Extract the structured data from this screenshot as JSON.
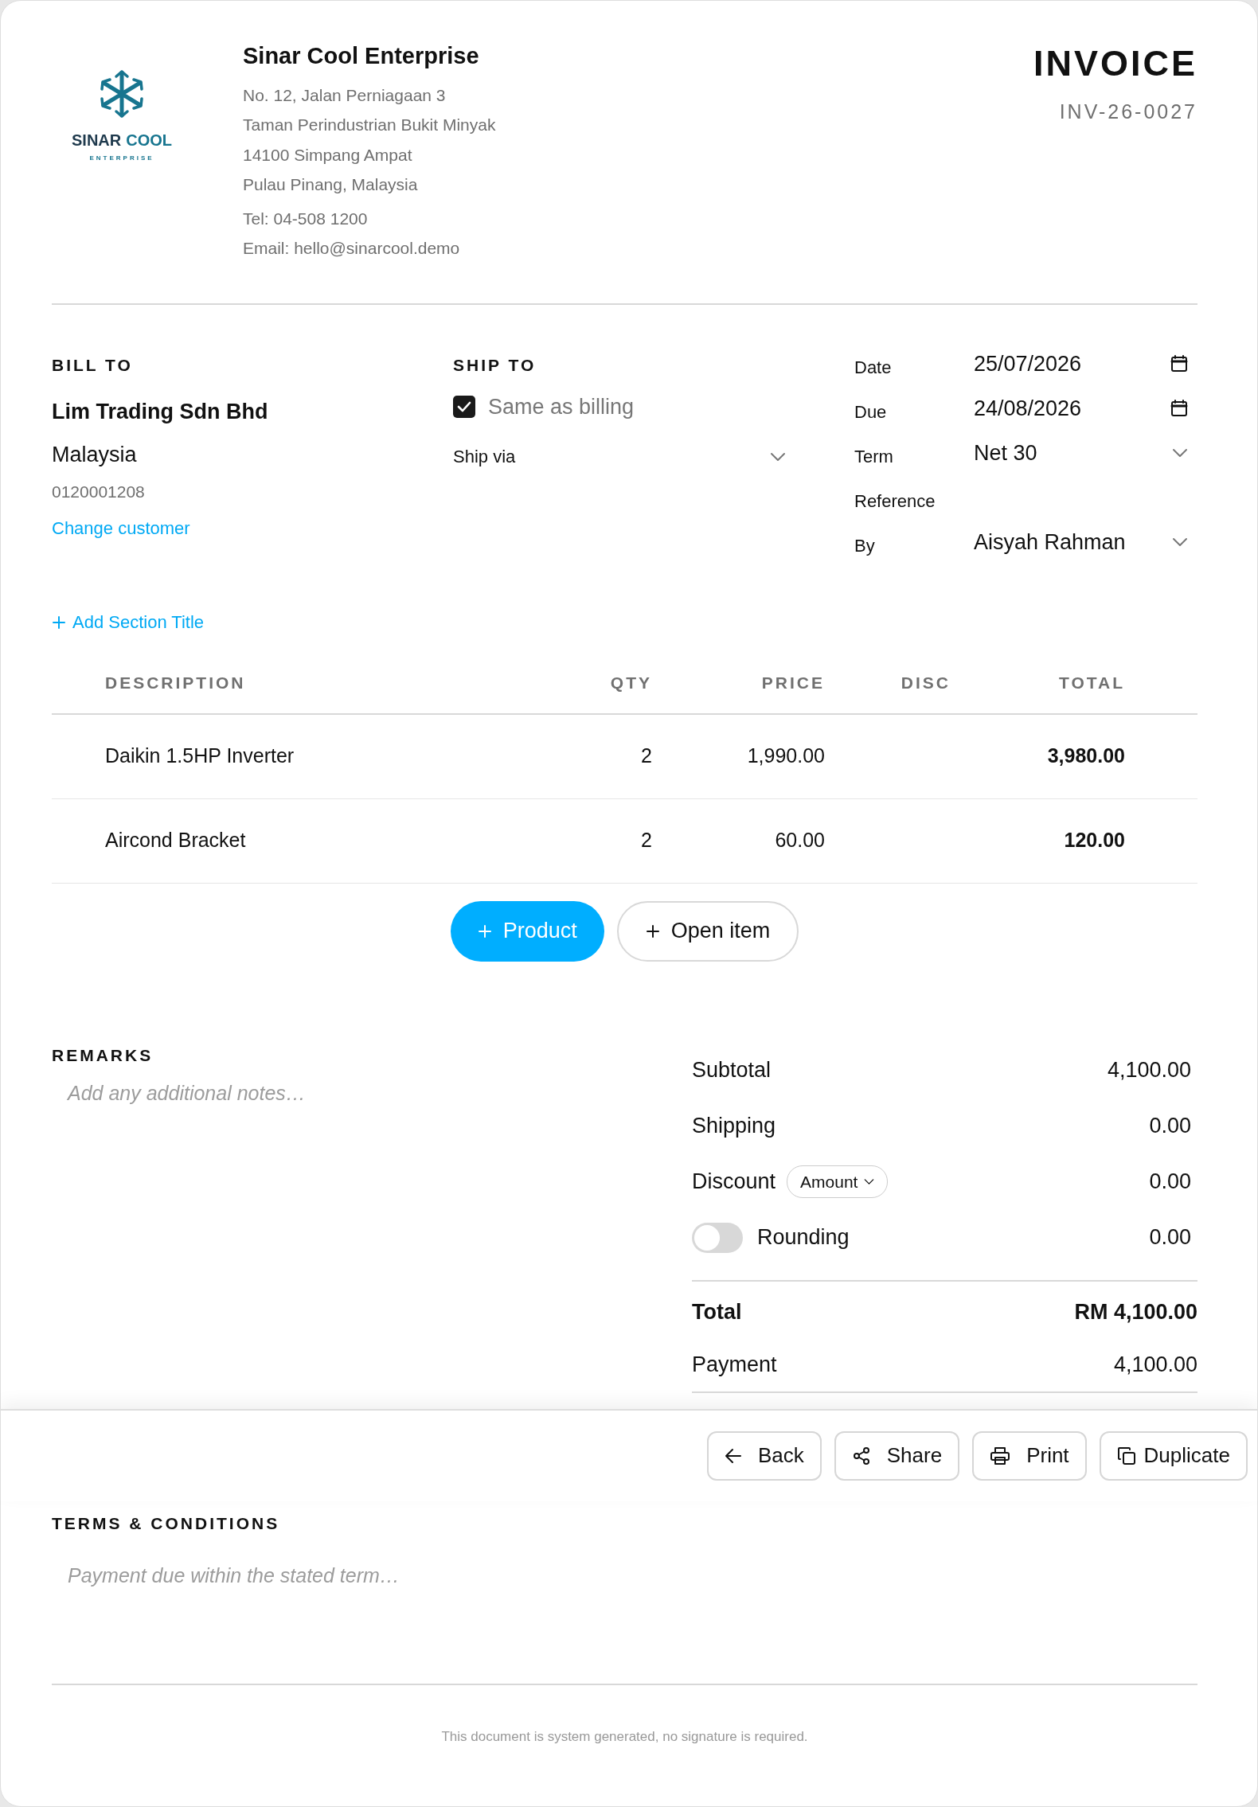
{
  "company": {
    "logo": {
      "words": [
        {
          "text": "SINAR",
          "color": "#1f3a4d"
        },
        {
          "text": "COOL",
          "color": "#17758f"
        }
      ],
      "tagline": "ENTERPRISE"
    },
    "name": "Sinar Cool Enterprise",
    "address_lines": [
      "No. 12, Jalan Perniagaan 3",
      "Taman Perindustrian Bukit Minyak",
      "14100 Simpang Ampat",
      "Pulau Pinang, Malaysia"
    ],
    "contact_lines": [
      "Tel: 04-508 1200",
      "Email: hello@sinarcool.demo"
    ]
  },
  "document": {
    "title": "INVOICE",
    "number": "INV-26-0027"
  },
  "bill_to": {
    "heading": "BILL TO",
    "name": "Lim Trading Sdn Bhd",
    "country": "Malaysia",
    "phone": "0120001208",
    "link": "Change customer"
  },
  "ship_to": {
    "heading": "SHIP TO",
    "same_as_billing": {
      "label": "Same as billing",
      "checked": true
    },
    "ship_via": {
      "placeholder": "Ship via"
    }
  },
  "meta": [
    {
      "label": "Date",
      "value": "25/07/2026",
      "kind": "date"
    },
    {
      "label": "Due",
      "value": "24/08/2026",
      "kind": "date"
    },
    {
      "label": "Term",
      "value": "Net 30",
      "kind": "select"
    },
    {
      "label": "Reference",
      "kind": "text"
    },
    {
      "label": "By",
      "value": "Aisyah Rahman",
      "kind": "select"
    }
  ],
  "add_section": "Add Section Title",
  "table": {
    "columns": [
      "DESCRIPTION",
      "QTY",
      "PRICE",
      "DISC",
      "TOTAL"
    ],
    "rows": [
      {
        "description": "Daikin 1.5HP Inverter",
        "qty": "2",
        "price": "1,990.00",
        "total": "3,980.00"
      },
      {
        "description": "Aircond Bracket",
        "qty": "2",
        "price": "60.00",
        "total": "120.00"
      }
    ]
  },
  "add_buttons": [
    {
      "label": "Product",
      "kind": "primary"
    },
    {
      "label": "Open item",
      "kind": "outline"
    }
  ],
  "remarks": {
    "heading": "REMARKS",
    "placeholder": "Add any additional notes…"
  },
  "totals": [
    {
      "label": "Subtotal",
      "value": "4,100.00",
      "kind": "plain"
    },
    {
      "label": "Shipping",
      "value": "0.00",
      "kind": "plain"
    },
    {
      "label": "Discount",
      "value": "0.00",
      "kind": "discount",
      "mode": "Amount"
    },
    {
      "label": "Rounding",
      "value": "0.00",
      "kind": "toggle",
      "on": false
    }
  ],
  "grand_total": {
    "label": "Total",
    "value": "RM 4,100.00"
  },
  "payment": {
    "label": "Payment",
    "value": "4,100.00"
  },
  "actions": [
    {
      "label": "Back",
      "kind": "back"
    },
    {
      "label": "Share",
      "kind": "share"
    },
    {
      "label": "Print",
      "kind": "print"
    },
    {
      "label": "Duplicate",
      "kind": "duplicate"
    }
  ],
  "terms": {
    "heading": "TERMS & CONDITIONS",
    "placeholder": "Payment due within the stated term…"
  },
  "footer_note": "This document is system generated, no signature is required."
}
